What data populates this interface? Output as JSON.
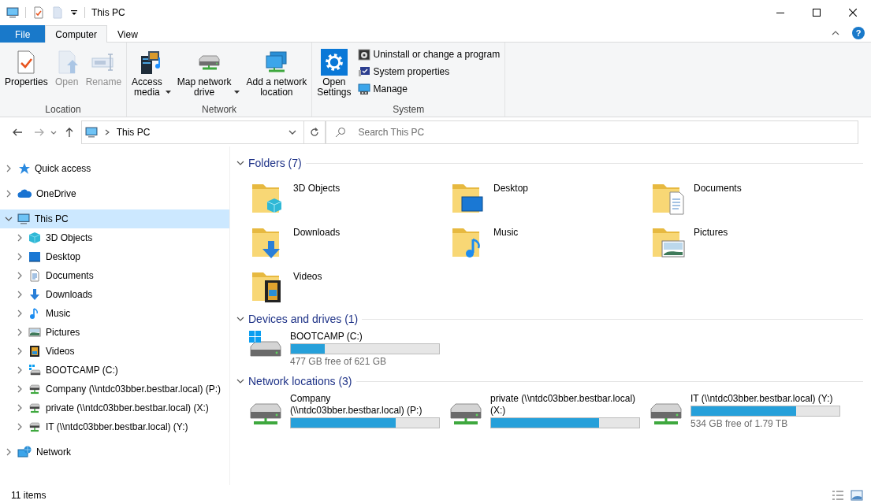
{
  "window": {
    "title": "This PC"
  },
  "ribbon": {
    "tabs": [
      {
        "label": "File",
        "kind": "file",
        "selected": false
      },
      {
        "label": "Computer",
        "kind": "tab",
        "selected": true
      },
      {
        "label": "View",
        "kind": "tab",
        "selected": false
      }
    ],
    "help": "?",
    "groups": [
      {
        "title": "Location",
        "items": [
          {
            "lines": [
              "Properties"
            ],
            "disabled": false,
            "dropdown": false
          },
          {
            "lines": [
              "Open"
            ],
            "disabled": true,
            "dropdown": false
          },
          {
            "lines": [
              "Rename"
            ],
            "disabled": true,
            "dropdown": false
          }
        ]
      },
      {
        "title": "Network",
        "items": [
          {
            "lines": [
              "Access",
              "media"
            ],
            "disabled": false,
            "dropdown": true
          },
          {
            "lines": [
              "Map network",
              "drive"
            ],
            "disabled": false,
            "dropdown": true
          },
          {
            "lines": [
              "Add a network",
              "location"
            ],
            "disabled": false,
            "dropdown": false
          }
        ]
      },
      {
        "title": "System",
        "items": [
          {
            "lines": [
              "Open",
              "Settings"
            ],
            "disabled": false,
            "dropdown": false
          }
        ],
        "small_items": [
          "Uninstall or change a program",
          "System properties",
          "Manage"
        ]
      }
    ]
  },
  "address": {
    "path": [
      "This PC"
    ],
    "search_placeholder": "Search This PC"
  },
  "nav": [
    {
      "label": "Quick access",
      "expanded": false,
      "selected": false
    },
    {
      "label": "OneDrive",
      "expanded": false,
      "selected": false
    },
    {
      "label": "This PC",
      "expanded": true,
      "selected": true,
      "children": [
        {
          "label": "3D Objects",
          "expanded": false,
          "selected": false
        },
        {
          "label": "Desktop",
          "expanded": false,
          "selected": false
        },
        {
          "label": "Documents",
          "expanded": false,
          "selected": false
        },
        {
          "label": "Downloads",
          "expanded": false,
          "selected": false
        },
        {
          "label": "Music",
          "expanded": false,
          "selected": false
        },
        {
          "label": "Pictures",
          "expanded": false,
          "selected": false
        },
        {
          "label": "Videos",
          "expanded": false,
          "selected": false
        },
        {
          "label": "BOOTCAMP (C:)",
          "expanded": false,
          "selected": false
        },
        {
          "label": "Company (\\\\ntdc03bber.bestbar.local) (P:)",
          "expanded": false,
          "selected": false
        },
        {
          "label": "private (\\\\ntdc03bber.bestbar.local) (X:)",
          "expanded": false,
          "selected": false
        },
        {
          "label": "IT (\\\\ntdc03bber.bestbar.local) (Y:)",
          "expanded": false,
          "selected": false
        }
      ]
    },
    {
      "label": "Network",
      "expanded": false,
      "selected": false
    }
  ],
  "sections": [
    {
      "title": "Folders (7)",
      "kind": "folders",
      "expanded": true,
      "items": [
        {
          "label": "3D Objects"
        },
        {
          "label": "Desktop"
        },
        {
          "label": "Documents"
        },
        {
          "label": "Downloads"
        },
        {
          "label": "Music"
        },
        {
          "label": "Pictures"
        },
        {
          "label": "Videos"
        }
      ]
    },
    {
      "title": "Devices and drives (1)",
      "kind": "local-drives",
      "expanded": true,
      "items": [
        {
          "label": "BOOTCAMP (C:)",
          "level": 0.23,
          "detail": "477 GB free of 621 GB"
        }
      ]
    },
    {
      "title": "Network locations (3)",
      "kind": "network-drives",
      "expanded": true,
      "items": [
        {
          "label": "Company (\\\\ntdc03bber.bestbar.local) (P:)",
          "level": 0.71
        },
        {
          "label": "private (\\\\ntdc03bber.bestbar.local) (X:)",
          "level": 0.73
        },
        {
          "label": "IT (\\\\ntdc03bber.bestbar.local) (Y:)",
          "level": 0.71,
          "detail": "534 GB free of 1.79 TB"
        }
      ]
    }
  ],
  "status_bar": {
    "count": "11 items"
  }
}
